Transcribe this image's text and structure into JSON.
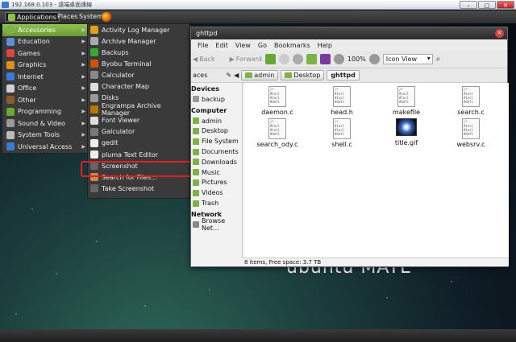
{
  "remote_title": "192.168.0.103 - 遠端桌面連線",
  "topbar": {
    "apps": "Applications",
    "places": "Places",
    "system": "System"
  },
  "menu1": [
    {
      "label": "Accessories",
      "icon_color": "#7cb342"
    },
    {
      "label": "Education",
      "icon_color": "#5c8fd6"
    },
    {
      "label": "Games",
      "icon_color": "#d44"
    },
    {
      "label": "Graphics",
      "icon_color": "#e08e20"
    },
    {
      "label": "Internet",
      "icon_color": "#3a7bd5"
    },
    {
      "label": "Office",
      "icon_color": "#d0d0d0"
    },
    {
      "label": "Other",
      "icon_color": "#8b5a2b"
    },
    {
      "label": "Programming",
      "icon_color": "#6a3"
    },
    {
      "label": "Sound & Video",
      "icon_color": "#999"
    },
    {
      "label": "System Tools",
      "icon_color": "#bbb"
    },
    {
      "label": "Universal Access",
      "icon_color": "#3a7bd5"
    }
  ],
  "menu2": [
    {
      "label": "Activity Log Manager",
      "icon_color": "#e0a020"
    },
    {
      "label": "Archive Manager",
      "icon_color": "#aaa"
    },
    {
      "label": "Backups",
      "icon_color": "#3a3"
    },
    {
      "label": "Byobu Terminal",
      "icon_color": "#c50"
    },
    {
      "label": "Calculator",
      "icon_color": "#888"
    },
    {
      "label": "Character Map",
      "icon_color": "#ddd"
    },
    {
      "label": "Disks",
      "icon_color": "#999"
    },
    {
      "label": "Engrampa Archive Manager",
      "icon_color": "#b70"
    },
    {
      "label": "Font Viewer",
      "icon_color": "#ddd"
    },
    {
      "label": "Galculator",
      "icon_color": "#777"
    },
    {
      "label": "gedit",
      "icon_color": "#eee"
    },
    {
      "label": "pluma Text Editor",
      "icon_color": "#eee"
    },
    {
      "label": "Screenshot",
      "icon_color": "#666"
    },
    {
      "label": "Search for Files...",
      "icon_color": "#c84"
    },
    {
      "label": "Take Screenshot",
      "icon_color": "#666"
    }
  ],
  "fm": {
    "title": "ghttpd",
    "menu": [
      "File",
      "Edit",
      "View",
      "Go",
      "Bookmarks",
      "Help"
    ],
    "back": "Back",
    "forward": "Forward",
    "zoom": "100%",
    "view": "Icon View",
    "path": [
      "admin",
      "Desktop",
      "ghttpd"
    ],
    "sidebar_devices": "Devices",
    "devices": [
      "backup"
    ],
    "sidebar_computer": "Computer",
    "computer": [
      "admin",
      "Desktop",
      "File System",
      "Documents",
      "Downloads",
      "Music",
      "Pictures",
      "Videos",
      "Trash"
    ],
    "sidebar_network": "Network",
    "network": [
      "Browse Net..."
    ],
    "files": [
      "daemon.c",
      "head.h",
      "makefile",
      "search.c",
      "search_ody.c",
      "shell.c",
      "title.gif",
      "websrv.c"
    ],
    "status": "8 items, Free space: 3.7 TB"
  },
  "desktop_brand": "ubuntu MATE"
}
